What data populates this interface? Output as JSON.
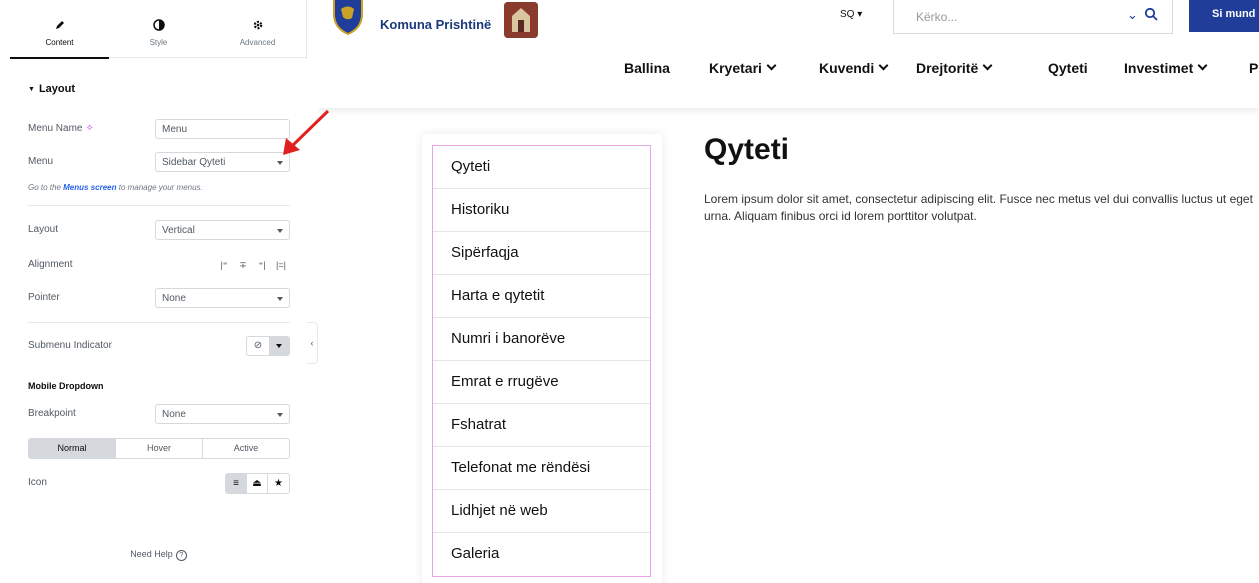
{
  "panel": {
    "tabs": [
      {
        "label": "Content",
        "icon": "pencil-icon",
        "active": true
      },
      {
        "label": "Style",
        "icon": "contrast-icon",
        "active": false
      },
      {
        "label": "Advanced",
        "icon": "gear-icon",
        "active": false
      }
    ],
    "section_title": "Layout",
    "menu_name": {
      "label": "Menu Name",
      "value": "Menu",
      "icon": "ai-sparkle-icon"
    },
    "menu": {
      "label": "Menu",
      "value": "Sidebar Qyteti"
    },
    "menus_hint": {
      "prefix": "Go to the ",
      "link": "Menus screen",
      "suffix": " to manage your menus."
    },
    "layout": {
      "label": "Layout",
      "value": "Vertical"
    },
    "alignment": {
      "label": "Alignment",
      "options": [
        "align-start-icon",
        "align-center-icon",
        "align-end-icon",
        "align-justify-icon"
      ]
    },
    "pointer": {
      "label": "Pointer",
      "value": "None"
    },
    "submenu_indicator": {
      "label": "Submenu Indicator"
    },
    "mobile_dropdown": {
      "title": "Mobile Dropdown"
    },
    "breakpoint": {
      "label": "Breakpoint",
      "value": "None"
    },
    "state_tabs": [
      "Normal",
      "Hover",
      "Active"
    ],
    "icon_row": {
      "label": "Icon",
      "options": [
        "hamburger-icon",
        "nav-icon",
        "star-icon"
      ]
    },
    "help": "Need Help",
    "help_glyph": "?",
    "collapse_glyph": "‹"
  },
  "site": {
    "brand": "Komuna Prishtinë",
    "lang": "SQ ▾",
    "search": {
      "placeholder": "Kërko...",
      "chevron_glyph": "⌄"
    },
    "cta": "Si mund",
    "nav": [
      {
        "label": "Ballina",
        "dropdown": false
      },
      {
        "label": "Kryetari",
        "dropdown": true
      },
      {
        "label": "Kuvendi",
        "dropdown": true
      },
      {
        "label": "Drejtoritë",
        "dropdown": true
      },
      {
        "label": "Qyteti",
        "dropdown": false
      },
      {
        "label": "Investimet",
        "dropdown": true
      },
      {
        "label": "P",
        "dropdown": false
      }
    ],
    "sidebar_menu": [
      "Qyteti",
      "Historiku",
      "Sipërfaqja",
      "Harta e qytetit",
      "Numri i banorëve",
      "Emrat e rrugëve",
      "Fshatrat",
      "Telefonat me rëndësi",
      "Lidhjet në web",
      "Galeria"
    ],
    "content": {
      "title": "Qyteti",
      "text": "Lorem ipsum dolor sit amet, consectetur adipiscing elit. Fusce nec metus vel dui convallis luctus ut eget urna. Aliquam finibus orci id lorem porttitor volutpat."
    }
  },
  "colors": {
    "brand_blue": "#1f3d99",
    "menu_border": "#e5a3e8",
    "annotation_red": "#e02020",
    "link_blue": "#2563eb"
  }
}
